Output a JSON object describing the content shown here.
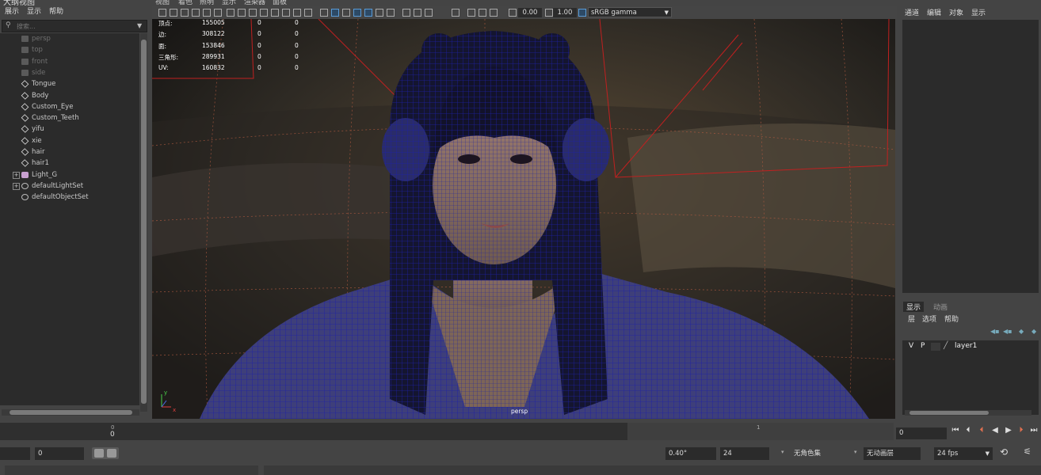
{
  "outliner": {
    "title": "大纲视图",
    "menu": [
      "展示",
      "显示",
      "帮助"
    ],
    "search_placeholder": "搜索...",
    "items": [
      {
        "label": "persp",
        "icon": "camera-icon",
        "dim": true
      },
      {
        "label": "top",
        "icon": "camera-icon",
        "dim": true
      },
      {
        "label": "front",
        "icon": "camera-icon",
        "dim": true
      },
      {
        "label": "side",
        "icon": "camera-icon",
        "dim": true
      },
      {
        "label": "Tongue",
        "icon": "mesh-icon",
        "dim": false
      },
      {
        "label": "Body",
        "icon": "mesh-icon",
        "dim": false
      },
      {
        "label": "Custom_Eye",
        "icon": "mesh-icon",
        "dim": false
      },
      {
        "label": "Custom_Teeth",
        "icon": "mesh-icon",
        "dim": false
      },
      {
        "label": "yifu",
        "icon": "mesh-icon",
        "dim": false
      },
      {
        "label": "xie",
        "icon": "mesh-icon",
        "dim": false
      },
      {
        "label": "hair",
        "icon": "mesh-icon",
        "dim": false
      },
      {
        "label": "hair1",
        "icon": "mesh-icon",
        "dim": false
      },
      {
        "label": "Light_G",
        "icon": "light-group-icon",
        "dim": false,
        "expandable": true
      },
      {
        "label": "defaultLightSet",
        "icon": "set-icon",
        "dim": false,
        "expandable": true
      },
      {
        "label": "defaultObjectSet",
        "icon": "set-icon",
        "dim": false
      }
    ]
  },
  "viewport": {
    "menu": [
      "视图",
      "着色",
      "照明",
      "显示",
      "渲染器",
      "面板"
    ],
    "exposure": "0.00",
    "gamma": "1.00",
    "colorspace": "sRGB gamma",
    "hud": {
      "rows": [
        {
          "label": "顶点:",
          "value": "155005",
          "sel": "0",
          "comp": "0"
        },
        {
          "label": "边:",
          "value": "308122",
          "sel": "0",
          "comp": "0"
        },
        {
          "label": "面:",
          "value": "153846",
          "sel": "0",
          "comp": "0"
        },
        {
          "label": "三角形:",
          "value": "289931",
          "sel": "0",
          "comp": "0"
        },
        {
          "label": "UV:",
          "value": "160832",
          "sel": "0",
          "comp": "0"
        }
      ]
    },
    "camera_label": "persp",
    "axis_y": "y",
    "axis_x": "x"
  },
  "channel_box": {
    "menu": [
      "通道",
      "编辑",
      "对象",
      "显示"
    ]
  },
  "layer_editor": {
    "tabs": [
      "显示",
      "动画"
    ],
    "menu": [
      "层",
      "选项",
      "帮助"
    ],
    "layer": {
      "v": "V",
      "p": "P",
      "name": "layer1"
    }
  },
  "timeline": {
    "start_tick": "0",
    "start_value": "0",
    "end_tick": "1",
    "current_frame": "0"
  },
  "range": {
    "start": "0",
    "angle": "0.40°",
    "fps_field": "24",
    "character_set": "无角色集",
    "anim_layer": "无动画层",
    "fps": "24 fps"
  }
}
